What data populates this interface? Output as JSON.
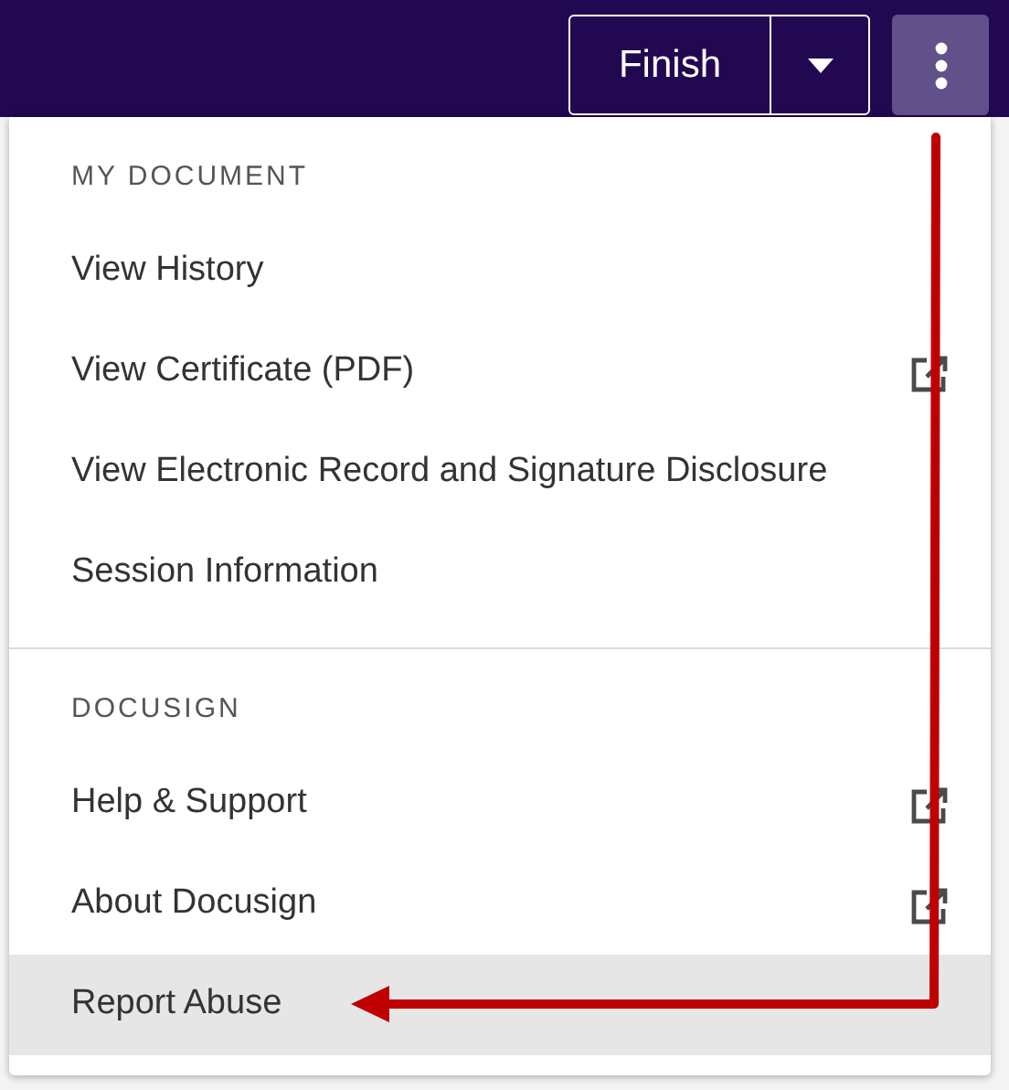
{
  "toolbar": {
    "finish_button": "Finish"
  },
  "menu": {
    "sections": [
      {
        "heading": "MY DOCUMENT",
        "items": [
          {
            "label": "View History",
            "external": false,
            "selected": false
          },
          {
            "label": "View Certificate (PDF)",
            "external": true,
            "selected": false
          },
          {
            "label": "View Electronic Record and Signature Disclosure",
            "external": false,
            "selected": false
          },
          {
            "label": "Session Information",
            "external": false,
            "selected": false
          }
        ]
      },
      {
        "heading": "DOCUSIGN",
        "items": [
          {
            "label": "Help & Support",
            "external": true,
            "selected": false
          },
          {
            "label": "About Docusign",
            "external": true,
            "selected": false
          },
          {
            "label": "Report Abuse",
            "external": false,
            "selected": true
          }
        ]
      }
    ]
  }
}
